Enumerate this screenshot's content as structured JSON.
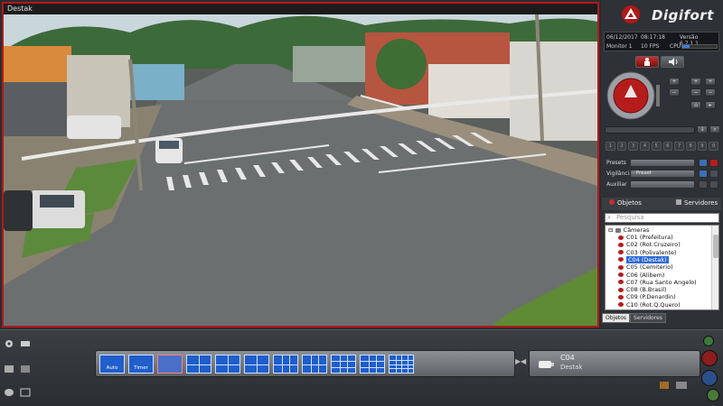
{
  "video": {
    "title": "Destak"
  },
  "logo": {
    "text": "Digifort"
  },
  "status": {
    "date": "06/12/2017",
    "time": "08:17:18",
    "version": "Versão 6.7.1.1",
    "monitor": "Monitor 1",
    "fps": "10 FPS",
    "cpu_label": "CPU",
    "cpu_level": 0.2
  },
  "ptz": {
    "numbers": [
      "1",
      "2",
      "3",
      "4",
      "5",
      "6",
      "7",
      "8",
      "9",
      "0"
    ]
  },
  "panel_rows": {
    "presets_label": "Presets",
    "presets_value": "",
    "vigilancia_label": "Vigilância",
    "vigilancia_value": "- Preset",
    "auxiliar_label": "Auxiliar",
    "auxiliar_value": ""
  },
  "objects": {
    "tab_objects": "Objetos",
    "tab_servers": "Servidores",
    "search_placeholder": "Pesquisa",
    "root": "Câmeras",
    "cameras": [
      "C01 (Prefeitura)",
      "C02 (Rot.Cruzeiro)",
      "C03 (Polivalente)",
      "C04 (Destak)",
      "C05 (Cemiterio)",
      "C06 (Alibem)",
      "C07 (Rua Santo Angelo)",
      "C08 (B.Brasil)",
      "C09 (P.Denardin)",
      "C10 (Rot.Q.Quero)"
    ],
    "selected_index": 3,
    "bottom_tab_objects": "Objetos",
    "bottom_tab_servers": "Servidores"
  },
  "toolbar": {
    "layout_buttons": [
      {
        "caption": "Auto"
      },
      {
        "caption": "Timer"
      },
      {
        "caption": ""
      },
      {
        "caption": ""
      },
      {
        "caption": ""
      },
      {
        "caption": ""
      },
      {
        "caption": ""
      },
      {
        "caption": ""
      },
      {
        "caption": ""
      },
      {
        "caption": ""
      },
      {
        "caption": ""
      }
    ],
    "camera_name": "C04",
    "camera_description": "Destak"
  },
  "colors": {
    "accent_red": "#b21818",
    "selection_blue": "#2d6ad6",
    "layout_blue": "#1f5ecb"
  }
}
